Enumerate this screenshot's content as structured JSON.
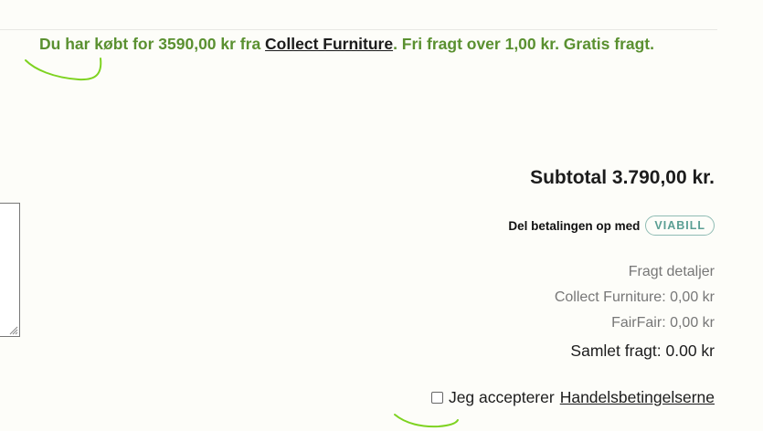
{
  "banner": {
    "prefix": "Du har købt for 3590,00 kr fra",
    "vendor_link": "Collect Furniture",
    "suffix": ". Fri fragt over 1,00 kr. Gratis fragt.",
    "color": "#5a9030"
  },
  "summary": {
    "subtotal": "Subtotal 3.790,00 kr."
  },
  "viabill": {
    "text": "Del betalingen op med",
    "logo_text": "VIABILL",
    "color": "#5a9e93"
  },
  "freight": {
    "header": "Fragt detaljer",
    "lines": [
      "Collect Furniture: 0,00 kr",
      "FairFair: 0,00 kr"
    ],
    "total": "Samlet fragt: 0.00 kr"
  },
  "terms": {
    "label": "Jeg accepterer",
    "link": "Handelsbetingelserne",
    "checked": false
  },
  "annotation_color": "#7ed321"
}
